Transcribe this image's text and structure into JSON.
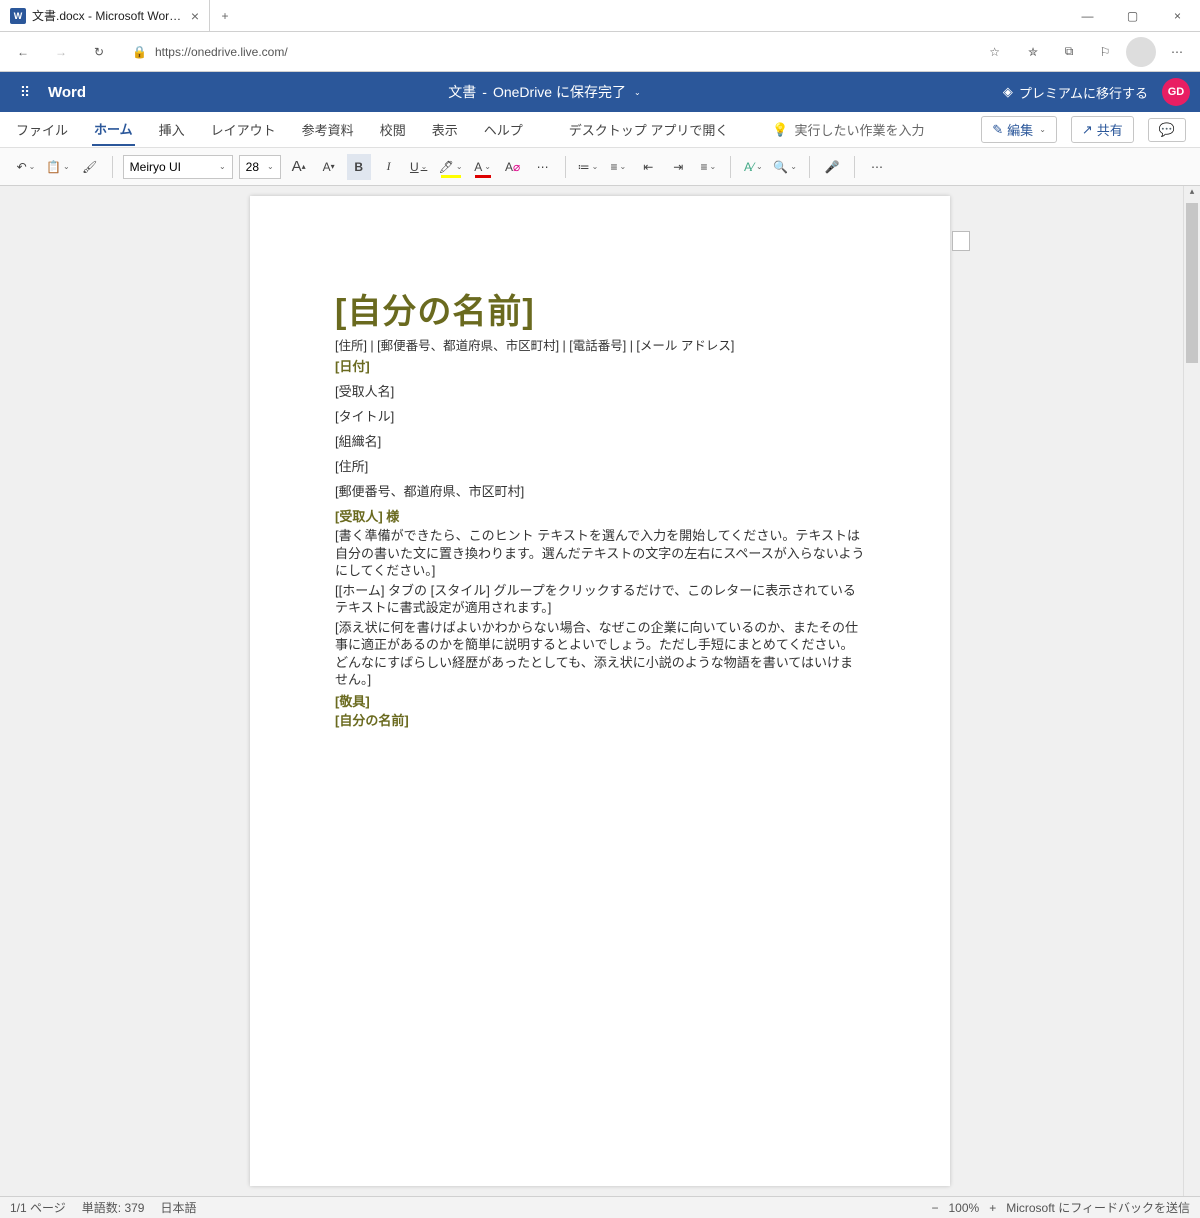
{
  "browser": {
    "tab_title": "文書.docx - Microsoft Word Onli",
    "url": "https://onedrive.live.com/"
  },
  "header": {
    "brand": "Word",
    "doc_title": "文書",
    "save_status": "OneDrive に保存完了",
    "premium_label": "プレミアムに移行する",
    "avatar": "GD"
  },
  "ribbon": {
    "tabs": [
      "ファイル",
      "ホーム",
      "挿入",
      "レイアウト",
      "参考資料",
      "校閲",
      "表示",
      "ヘルプ"
    ],
    "open_desktop": "デスクトップ アプリで開く",
    "tell_me_placeholder": "実行したい作業を入力",
    "edit_label": "編集",
    "share_label": "共有"
  },
  "toolbar": {
    "font_name": "Meiryo UI",
    "font_size": "28"
  },
  "document": {
    "title": "[自分の名前]",
    "info_line": "[住所] | [郵便番号、都道府県、市区町村] | [電話番号] | [メール アドレス]",
    "date": "[日付]",
    "recipient_name": "[受取人名]",
    "job_title": "[タイトル]",
    "org": "[組織名]",
    "addr": "[住所]",
    "postal": "[郵便番号、都道府県、市区町村]",
    "salutation": "[受取人] 様",
    "para1": "[書く準備ができたら、このヒント テキストを選んで入力を開始してください。テキストは自分の書いた文に置き換わります。選んだテキストの文字の左右にスペースが入らないようにしてください。]",
    "para2": "[[ホーム] タブの [スタイル] グループをクリックするだけで、このレターに表示されているテキストに書式設定が適用されます。]",
    "para3": "[添え状に何を書けばよいかわからない場合、なぜこの企業に向いているのか、またその仕事に適正があるのかを簡単に説明するとよいでしょう。ただし手短にまとめてください。どんなにすばらしい経歴があったとしても、添え状に小説のような物語を書いてはいけません。]",
    "closing": "[敬具]",
    "signature": "[自分の名前]"
  },
  "status": {
    "page": "1/1 ページ",
    "words": "単語数: 379",
    "lang": "日本語",
    "zoom": "100%",
    "feedback": "Microsoft にフィードバックを送信"
  }
}
